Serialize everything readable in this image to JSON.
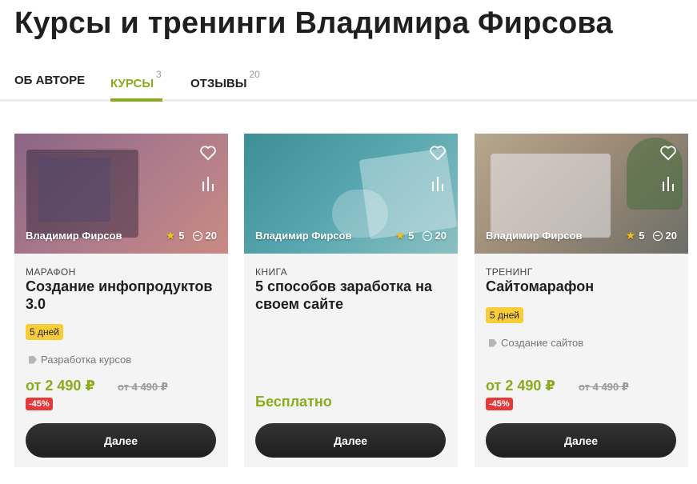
{
  "page": {
    "title": "Курсы и тренинги Владимира Фирсова"
  },
  "tabs": [
    {
      "label": "ОБ АВТОРЕ",
      "count": ""
    },
    {
      "label": "КУРСЫ",
      "count": "3"
    },
    {
      "label": "ОТЗЫВЫ",
      "count": "20"
    }
  ],
  "colors": {
    "accent": "#8bab1d",
    "badge": "#f9cd3a",
    "discount": "#e53a3a",
    "button": "#1f1f1f"
  },
  "cards": [
    {
      "author": "Владимир Фирсов",
      "rating": "5",
      "comments": "20",
      "type": "МАРАФОН",
      "title": "Создание инфопродуктов 3.0",
      "duration": "5 дней",
      "tag": "Разработка курсов",
      "price": "от 2 490 ₽",
      "old_price": "от 4 490 ₽",
      "discount": "-45%",
      "button": "Далее"
    },
    {
      "author": "Владимир Фирсов",
      "rating": "5",
      "comments": "20",
      "type": "КНИГА",
      "title": "5 способов заработка на своем сайте",
      "free_label": "Бесплатно",
      "button": "Далее"
    },
    {
      "author": "Владимир Фирсов",
      "rating": "5",
      "comments": "20",
      "type": "ТРЕНИНГ",
      "title": "Сайтомарафон",
      "duration": "5 дней",
      "tag": "Создание сайтов",
      "price": "от 2 490 ₽",
      "old_price": "от 4 490 ₽",
      "discount": "-45%",
      "button": "Далее"
    }
  ]
}
